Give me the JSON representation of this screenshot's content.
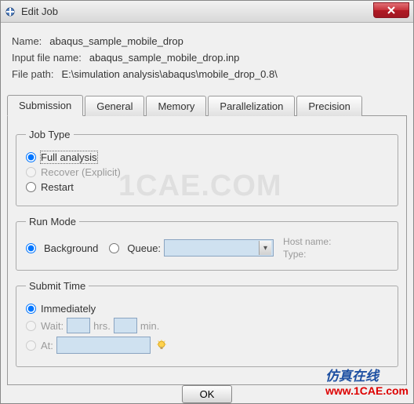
{
  "window": {
    "title": "Edit Job"
  },
  "info": {
    "name_label": "Name:",
    "name_value": "abaqus_sample_mobile_drop",
    "inputfile_label": "Input file name:",
    "inputfile_value": "abaqus_sample_mobile_drop.inp",
    "filepath_label": "File path:",
    "filepath_value": "E:\\simulation analysis\\abaqus\\mobile_drop_0.8\\"
  },
  "tabs": {
    "submission": "Submission",
    "general": "General",
    "memory": "Memory",
    "parallelization": "Parallelization",
    "precision": "Precision"
  },
  "jobtype": {
    "legend": "Job Type",
    "full": "Full analysis",
    "recover": "Recover (Explicit)",
    "restart": "Restart"
  },
  "runmode": {
    "legend": "Run Mode",
    "background": "Background",
    "queue": "Queue:",
    "hostname": "Host name:",
    "type": "Type:"
  },
  "submittime": {
    "legend": "Submit Time",
    "immediately": "Immediately",
    "wait": "Wait:",
    "hrs": "hrs.",
    "min": "min.",
    "at": "At:"
  },
  "buttons": {
    "ok": "OK"
  },
  "watermarks": {
    "main": "1CAE.COM",
    "cn": "仿真在线",
    "url": "www.1CAE.com"
  }
}
